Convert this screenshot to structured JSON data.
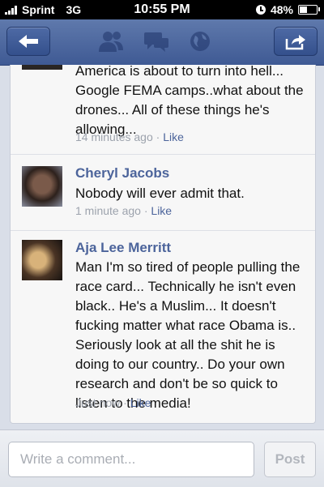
{
  "status_bar": {
    "carrier": "Sprint",
    "network": "3G",
    "time": "10:55 PM",
    "battery_percent": "48%",
    "battery_level": 0.48,
    "signal_bars": 4
  },
  "nav": {
    "back_icon": "back-arrow-icon",
    "friends_icon": "friends-icon",
    "messages_icon": "messages-icon",
    "notifications_icon": "globe-icon",
    "share_icon": "share-icon"
  },
  "comments": [
    {
      "name": "",
      "text": "America is about to turn into hell... Google FEMA camps..what about the drones... All of these things he's allowing...",
      "time": "14 minutes ago",
      "like": "Like"
    },
    {
      "name": "Cheryl Jacobs",
      "text": "Nobody will ever admit that.",
      "time": "1 minute ago",
      "like": "Like"
    },
    {
      "name": "Aja Lee Merritt",
      "text": "Man I'm so tired of people pulling the race card... Technically he isn't even black.. He's a Muslim... It doesn't fucking matter what race Obama is.. Seriously look at all the shit he is doing to our country.. Do your own research and don't be so quick to listen to the media!",
      "time": "Just now",
      "like": "Like"
    }
  ],
  "composer": {
    "placeholder": "Write a comment...",
    "post_label": "Post"
  }
}
